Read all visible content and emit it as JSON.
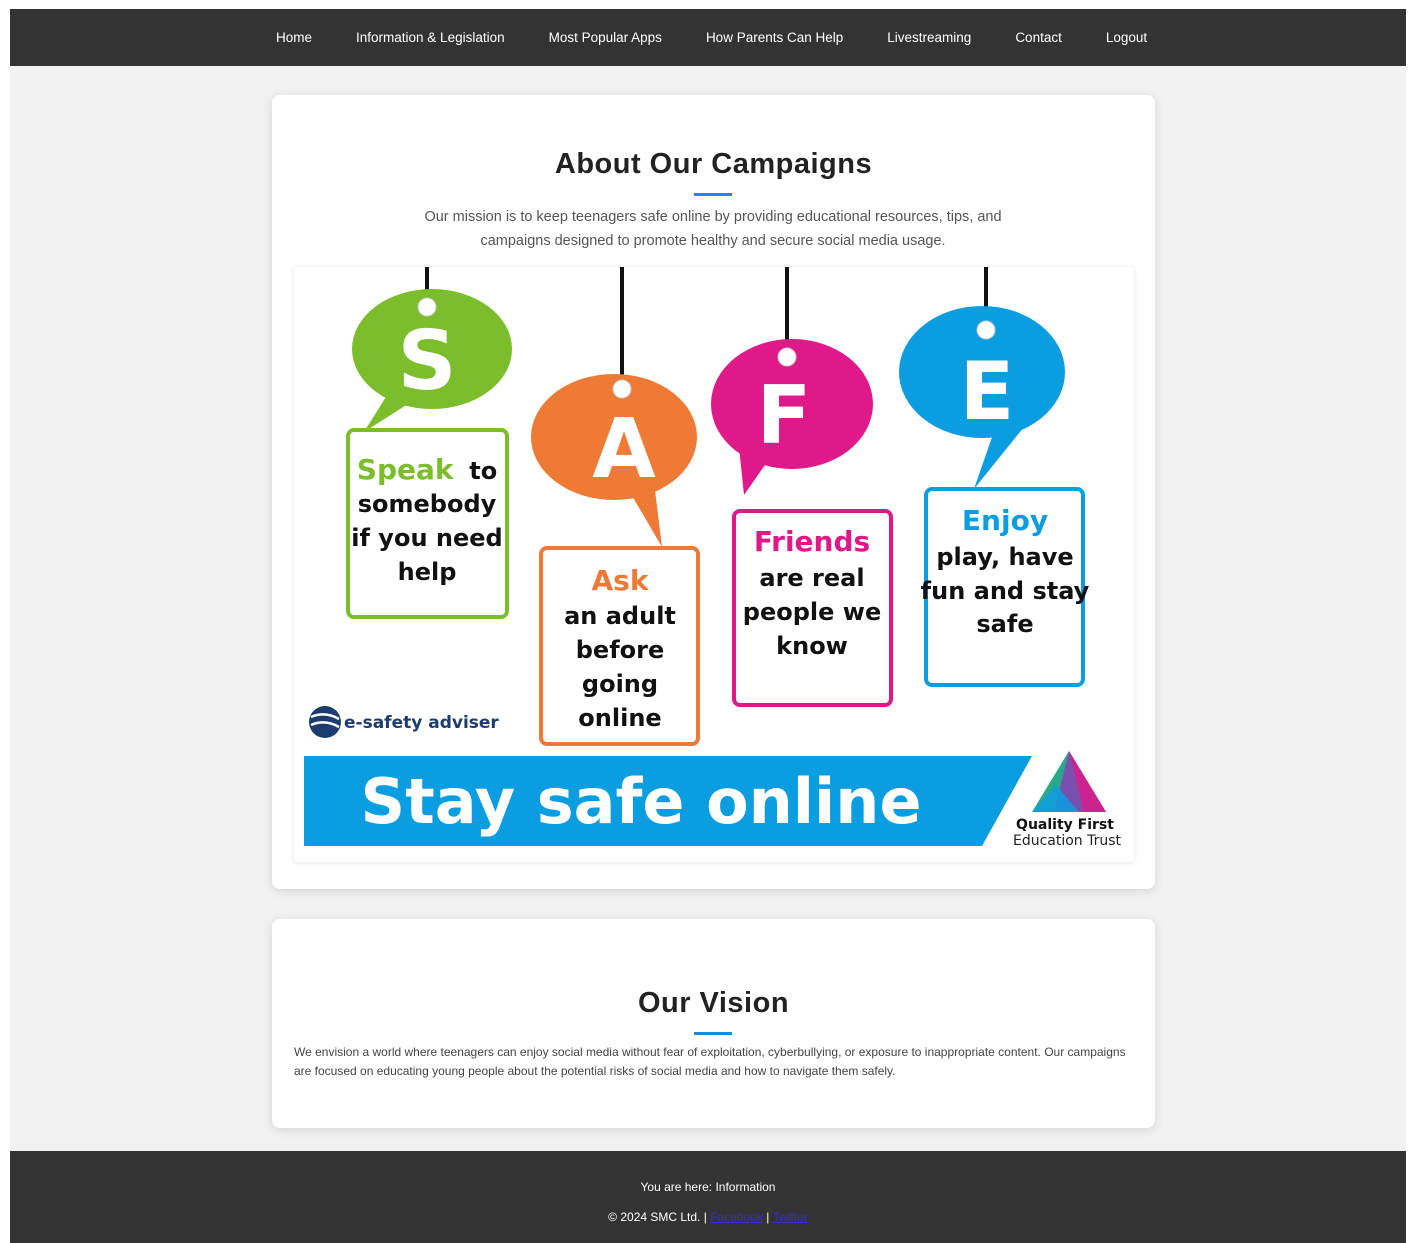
{
  "nav": {
    "items": [
      {
        "label": "Home"
      },
      {
        "label": "Information & Legislation"
      },
      {
        "label": "Most Popular Apps"
      },
      {
        "label": "How Parents Can Help"
      },
      {
        "label": "Livestreaming"
      },
      {
        "label": "Contact"
      },
      {
        "label": "Logout"
      }
    ]
  },
  "about": {
    "title": "About Our Campaigns",
    "mission": "Our mission is to keep teenagers safe online by providing educational resources, tips, and campaigns designed to promote healthy and secure social media usage."
  },
  "poster": {
    "letters": {
      "s": "S",
      "a": "A",
      "f": "F",
      "e": "E"
    },
    "cards": {
      "speak_head": "Speak",
      "speak_l1": "to",
      "speak_l2": "somebody",
      "speak_l3": "if you need",
      "speak_l4": "help",
      "ask_head": "Ask",
      "ask_l1": "an adult",
      "ask_l2": "before",
      "ask_l3": "going",
      "ask_l4": "online",
      "friends_head": "Friends",
      "friends_l1": "are real",
      "friends_l2": "people we",
      "friends_l3": "know",
      "enjoy_head": "Enjoy",
      "enjoy_l1": "play, have",
      "enjoy_l2": "fun and stay",
      "enjoy_l3": "safe"
    },
    "logo_text": "e-safety adviser",
    "banner": "Stay safe online",
    "trust_line1": "Quality First",
    "trust_line2": "Education Trust",
    "colors": {
      "green": "#7bbd2a",
      "orange": "#ee7a35",
      "pink": "#e0198a",
      "blue": "#0a9ee0",
      "navy": "#1c3b6e"
    }
  },
  "vision": {
    "title": "Our Vision",
    "text": "We envision a world where teenagers can enjoy social media without fear of exploitation, cyberbullying, or exposure to inappropriate content. Our campaigns are focused on educating young people about the potential risks of social media and how to navigate them safely."
  },
  "footer": {
    "here": "You are here: Information",
    "copyright": "© 2024 SMC Ltd. |",
    "sep": "|",
    "link1": "Facebook",
    "link2": "Twitter"
  }
}
